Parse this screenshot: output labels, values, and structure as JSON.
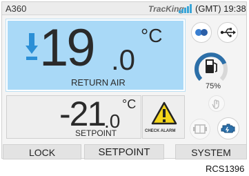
{
  "topbar": {
    "model": "A360",
    "brand": "TracKing",
    "signal_icon": "signal-bars-icon",
    "clock": "(GMT) 19:38"
  },
  "return_air": {
    "sign_icon": "arrow-down-icon",
    "value_int": "19",
    "value_dec": ".0",
    "unit": "°C",
    "label": "RETURN AIR"
  },
  "setpoint": {
    "value_int": "-21",
    "value_dec": ".0",
    "unit": "°C",
    "label": "SETPOINT"
  },
  "alarm": {
    "icon": "warning-triangle-icon",
    "label": "CHECK ALARM"
  },
  "side_icons": {
    "mode_icon": "mode-dots-icon",
    "usb_icon": "usb-icon",
    "fuel_icon": "fuel-pump-icon",
    "fuel_level": 0.75,
    "fuel_percent": "75%",
    "manual_icon": "hand-touch-icon",
    "door_icon": "door-icon",
    "engine_icon": "engine-icon"
  },
  "softkeys": {
    "left": "LOCK",
    "center": "SETPOINT",
    "right": "SYSTEM"
  },
  "footer_code": "RCS1396",
  "colors": {
    "return_panel": "#a9d9f7",
    "accent_blue": "#2b8fd6",
    "fuel_arc": "#2c6fa8"
  }
}
